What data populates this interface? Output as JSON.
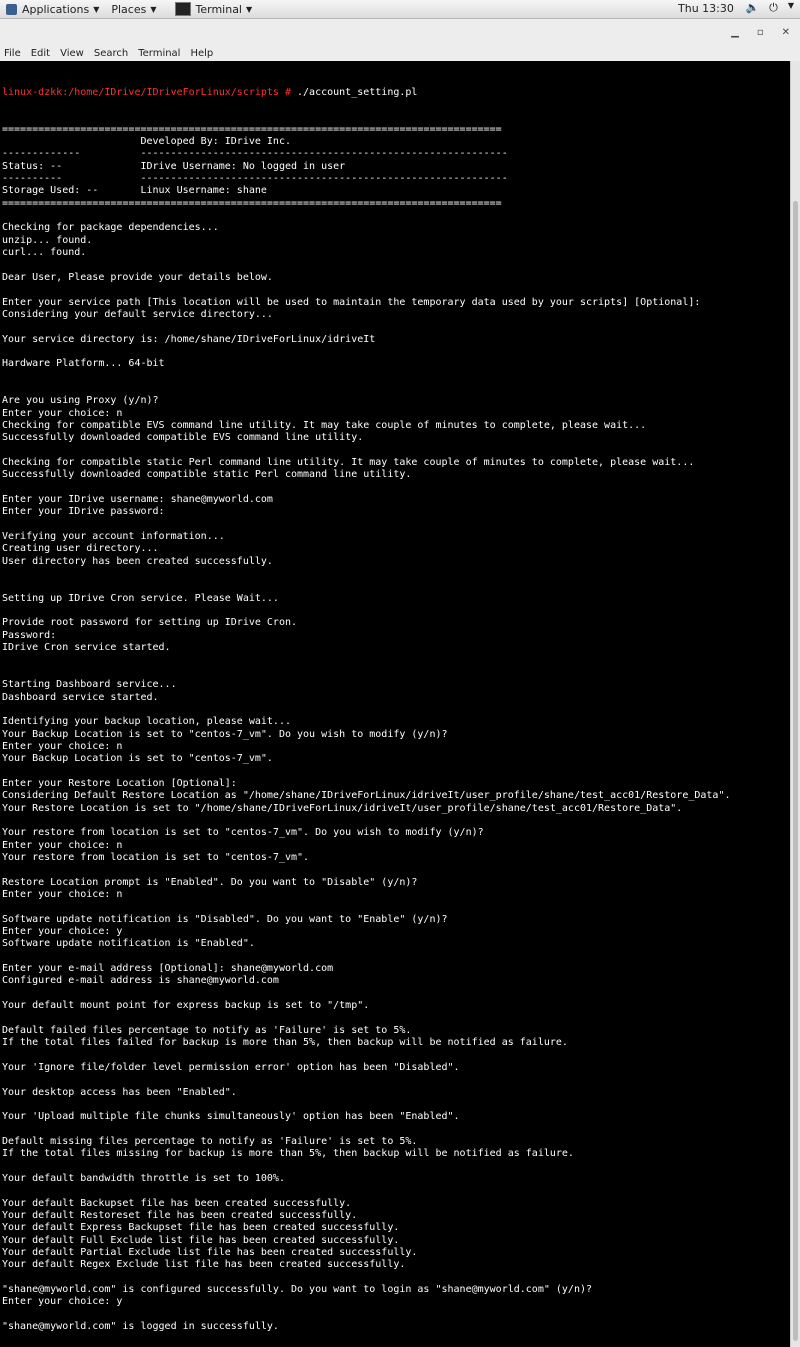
{
  "topbar": {
    "applications": "Applications",
    "places": "Places",
    "terminal_task": "Terminal",
    "clock": "Thu 13:30"
  },
  "menubar": [
    "File",
    "Edit",
    "View",
    "Search",
    "Terminal",
    "Help"
  ],
  "prompt": "linux-dzkk:/home/IDrive/IDriveForLinux/scripts #",
  "command": " ./account_setting.pl",
  "lines": [
    "===================================================================================",
    "                       Developed By: IDrive Inc.",
    "-------------          -------------------------------------------------------------",
    "Status: --             IDrive Username: No logged in user",
    "----------             -------------------------------------------------------------",
    "Storage Used: --       Linux Username: shane",
    "===================================================================================",
    "",
    "Checking for package dependencies...",
    "unzip... found.",
    "curl... found.",
    "",
    "Dear User, Please provide your details below.",
    "",
    "Enter your service path [This location will be used to maintain the temporary data used by your scripts] [Optional]:",
    "Considering your default service directory...",
    "",
    "Your service directory is: /home/shane/IDriveForLinux/idriveIt",
    "",
    "Hardware Platform... 64-bit",
    "",
    "",
    "Are you using Proxy (y/n)?",
    "Enter your choice: n",
    "Checking for compatible EVS command line utility. It may take couple of minutes to complete, please wait...",
    "Successfully downloaded compatible EVS command line utility.",
    "",
    "Checking for compatible static Perl command line utility. It may take couple of minutes to complete, please wait...",
    "Successfully downloaded compatible static Perl command line utility.",
    "",
    "Enter your IDrive username: shane@myworld.com",
    "Enter your IDrive password:",
    "",
    "Verifying your account information...",
    "Creating user directory...",
    "User directory has been created successfully.",
    "",
    "",
    "Setting up IDrive Cron service. Please Wait...",
    "",
    "Provide root password for setting up IDrive Cron.",
    "Password:",
    "IDrive Cron service started.",
    "",
    "",
    "Starting Dashboard service...",
    "Dashboard service started.",
    "",
    "Identifying your backup location, please wait...",
    "Your Backup Location is set to \"centos-7_vm\". Do you wish to modify (y/n)?",
    "Enter your choice: n",
    "Your Backup Location is set to \"centos-7_vm\".",
    "",
    "Enter your Restore Location [Optional]:",
    "Considering Default Restore Location as \"/home/shane/IDriveForLinux/idriveIt/user_profile/shane/test_acc01/Restore_Data\".",
    "Your Restore Location is set to \"/home/shane/IDriveForLinux/idriveIt/user_profile/shane/test_acc01/Restore_Data\".",
    "",
    "Your restore from location is set to \"centos-7_vm\". Do you wish to modify (y/n)?",
    "Enter your choice: n",
    "Your restore from location is set to \"centos-7_vm\".",
    "",
    "Restore Location prompt is \"Enabled\". Do you want to \"Disable\" (y/n)?",
    "Enter your choice: n",
    "",
    "Software update notification is \"Disabled\". Do you want to \"Enable\" (y/n)?",
    "Enter your choice: y",
    "Software update notification is \"Enabled\".",
    "",
    "Enter your e-mail address [Optional]: shane@myworld.com",
    "Configured e-mail address is shane@myworld.com",
    "",
    "Your default mount point for express backup is set to \"/tmp\".",
    "",
    "Default failed files percentage to notify as 'Failure' is set to 5%.",
    "If the total files failed for backup is more than 5%, then backup will be notified as failure.",
    "",
    "Your 'Ignore file/folder level permission error' option has been \"Disabled\".",
    "",
    "Your desktop access has been \"Enabled\".",
    "",
    "Your 'Upload multiple file chunks simultaneously' option has been \"Enabled\".",
    "",
    "Default missing files percentage to notify as 'Failure' is set to 5%.",
    "If the total files missing for backup is more than 5%, then backup will be notified as failure.",
    "",
    "Your default bandwidth throttle is set to 100%.",
    "",
    "Your default Backupset file has been created successfully.",
    "Your default Restoreset file has been created successfully.",
    "Your default Express Backupset file has been created successfully.",
    "Your default Full Exclude list file has been created successfully.",
    "Your default Partial Exclude list file has been created successfully.",
    "Your default Regex Exclude list file has been created successfully.",
    "",
    "\"shane@myworld.com\" is configured successfully. Do you want to login as \"shane@myworld.com\" (y/n)?",
    "Enter your choice: y",
    "",
    "\"shane@myworld.com\" is logged in successfully.",
    "",
    "",
    ""
  ]
}
